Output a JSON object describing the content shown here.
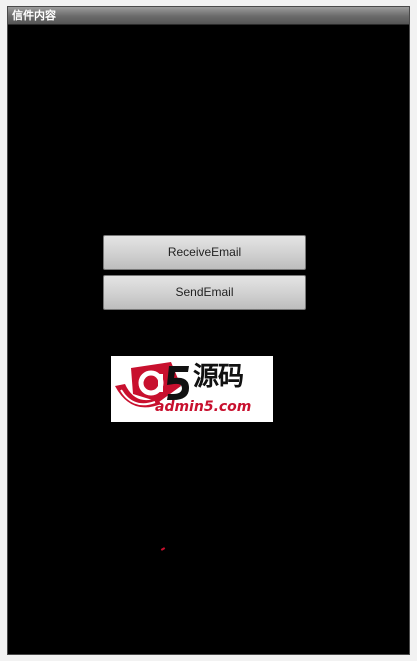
{
  "window": {
    "title": "信件内容"
  },
  "buttons": {
    "receive_label": "ReceiveEmail",
    "send_label": "SendEmail"
  },
  "logo": {
    "mark_letter": "a",
    "mark_number": "5",
    "brand_text": "源码",
    "url_text": "admin5.com",
    "colors": {
      "red": "#c8102e",
      "dark": "#111111"
    }
  },
  "colors": {
    "screen_background": "#000000",
    "titlebar": "#6a6a6a",
    "button_face": "#d2d2d2"
  }
}
